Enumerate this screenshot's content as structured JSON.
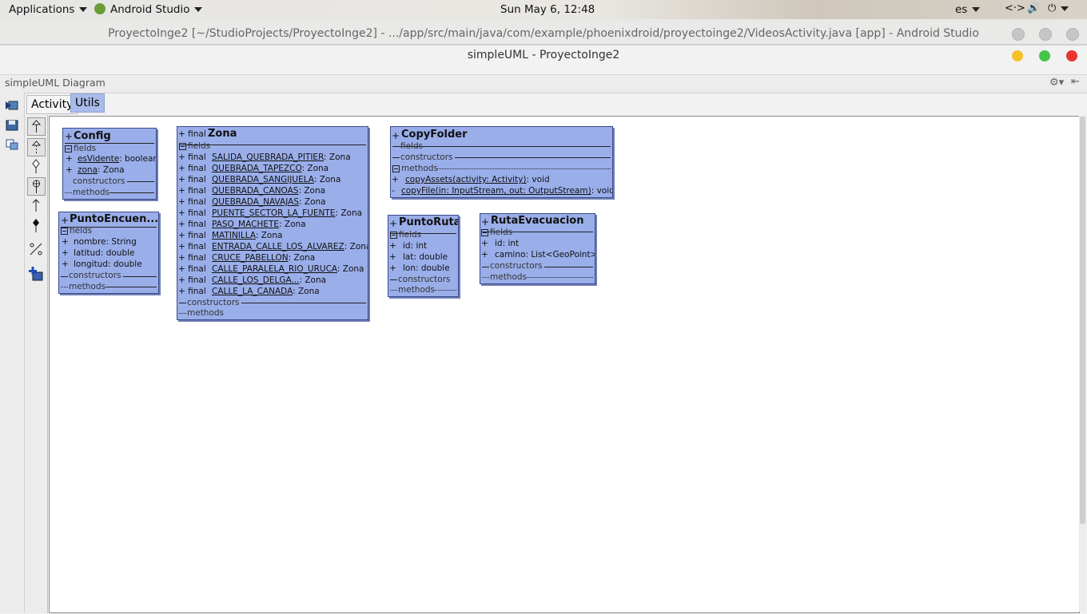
{
  "topbar": {
    "applications": "Applications",
    "app_name": "Android Studio",
    "clock": "Sun May  6, 12:48",
    "lang": "es"
  },
  "as_window": {
    "title": "ProyectoInge2 [~/StudioProjects/ProyectoInge2] - .../app/src/main/java/com/example/phoenixdroid/proyectoinge2/VideosActivity.java [app] - Android Studio"
  },
  "dialog": {
    "title": "simpleUML - ProyectoInge2",
    "colors": {
      "min": "#f5c02a",
      "max": "#45c44a",
      "close": "#e8352f"
    }
  },
  "toolwindow": {
    "label": "simpleUML Diagram"
  },
  "tabs": [
    {
      "label": "Activity"
    },
    {
      "label": "Utils"
    }
  ],
  "classes": {
    "config": {
      "name": "Config",
      "fields_label": "fields",
      "fields": [
        {
          "vis": "+",
          "name": "esVidente",
          "type": ": boolean"
        },
        {
          "vis": "+",
          "name": "zona",
          "type": ": Zona"
        }
      ],
      "constructors_label": "constructors",
      "methods_label": "methods"
    },
    "punto_encuentro": {
      "name": "PuntoEncuen...",
      "fields_label": "fields",
      "fields": [
        {
          "vis": "+",
          "name": "nombre",
          "type": ": String"
        },
        {
          "vis": "+",
          "name": "latitud",
          "type": ": double"
        },
        {
          "vis": "+",
          "name": "longitud",
          "type": ": double"
        }
      ],
      "constructors_label": "constructors",
      "methods_label": "methods"
    },
    "zona": {
      "modifier": "+ final",
      "name": "Zona",
      "fields_label": "fields",
      "fields": [
        {
          "vis": "+ final",
          "name": "SALIDA_QUEBRADA_PITIER",
          "type": ": Zona"
        },
        {
          "vis": "+ final",
          "name": "QUEBRADA_TAPEZCO",
          "type": ": Zona"
        },
        {
          "vis": "+ final",
          "name": "QUEBRADA_SANGIJUELA",
          "type": ": Zona"
        },
        {
          "vis": "+ final",
          "name": "QUEBRADA_CANOAS",
          "type": ": Zona"
        },
        {
          "vis": "+ final",
          "name": "QUEBRADA_NAVAJAS",
          "type": ": Zona"
        },
        {
          "vis": "+ final",
          "name": "PUENTE_SECTOR_LA_FUENTE",
          "type": ": Zona"
        },
        {
          "vis": "+ final",
          "name": "PASO_MACHETE",
          "type": ": Zona"
        },
        {
          "vis": "+ final",
          "name": "MATINILLA",
          "type": ": Zona"
        },
        {
          "vis": "+ final",
          "name": "ENTRADA_CALLE_LOS_ALVAREZ",
          "type": ": Zona"
        },
        {
          "vis": "+ final",
          "name": "CRUCE_PABELLON",
          "type": ": Zona"
        },
        {
          "vis": "+ final",
          "name": "CALLE_PARALELA_RIO_URUCA",
          "type": ": Zona"
        },
        {
          "vis": "+ final",
          "name": "CALLE_LOS_DELGA...",
          "type": ": Zona"
        },
        {
          "vis": "+ final",
          "name": "CALLE_LA_CANADA",
          "type": ": Zona"
        }
      ],
      "constructors_label": "constructors",
      "methods_label": "methods"
    },
    "copy_folder": {
      "name": "CopyFolder",
      "fields_label": "fields",
      "constructors_label": "constructors",
      "methods_label": "methods",
      "methods": [
        {
          "vis": "+",
          "name": "copyAssets(activity: Activity)",
          "type": ": void"
        },
        {
          "vis": "-",
          "name": "copyFile(in: InputStream,  out: OutputStream)",
          "type": ": void"
        }
      ]
    },
    "punto_ruta": {
      "name": "PuntoRuta",
      "fields_label": "fields",
      "fields": [
        {
          "vis": "+",
          "name": "id",
          "type": ": int"
        },
        {
          "vis": "+",
          "name": "lat",
          "type": ": double"
        },
        {
          "vis": "+",
          "name": "lon",
          "type": ": double"
        }
      ],
      "constructors_label": "constructors",
      "methods_label": "methods"
    },
    "ruta_evacuacion": {
      "name": "RutaEvacuacion",
      "fields_label": "fields",
      "fields": [
        {
          "vis": "+",
          "name": "id",
          "type": ": int"
        },
        {
          "vis": "+",
          "name": "camino",
          "type": ": List<GeoPoint>"
        }
      ],
      "constructors_label": "constructors",
      "methods_label": "methods"
    }
  }
}
